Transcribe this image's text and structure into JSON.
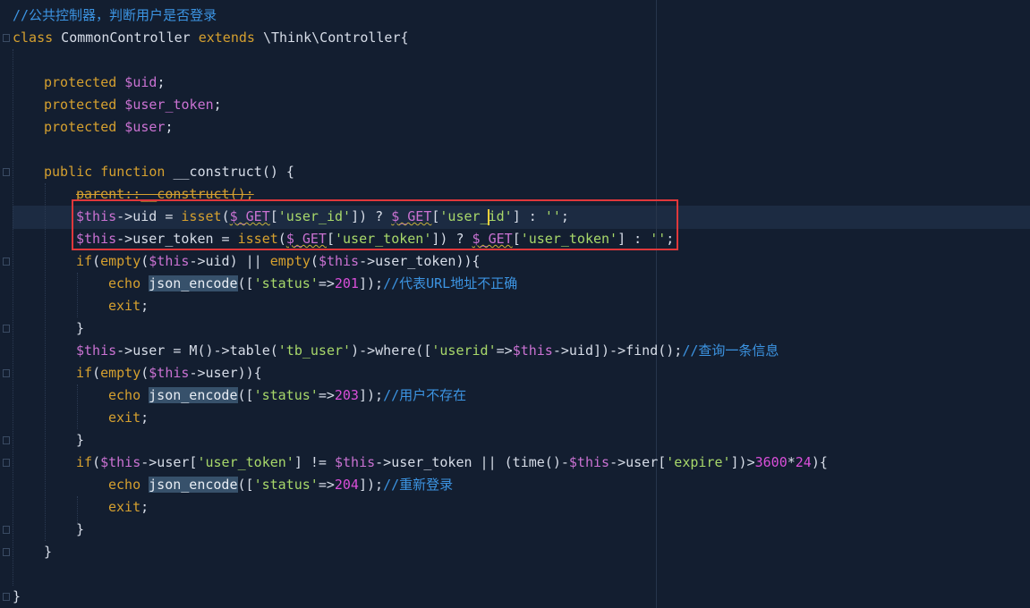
{
  "code": {
    "l1_comment": "//公共控制器，判断用户是否登录",
    "l2_class_kw": "class",
    "l2_class_name": " CommonController ",
    "l2_extends_kw": "extends",
    "l2_parent": " \\Think\\Controller{",
    "l3_prot": "protected",
    "l3_var": " $uid",
    "l3_end": ";",
    "l4_prot": "protected",
    "l4_var": " $user_token",
    "l4_end": ";",
    "l5_prot": "protected",
    "l5_var": " $user",
    "l5_end": ";",
    "l6_public": "public",
    "l6_function": " function",
    "l6_rest": " __construct() {",
    "l7_parent": "parent::__construct();",
    "l8_this": "$this",
    "l8_a": "->uid = ",
    "l8_isset": "isset",
    "l8_b": "(",
    "l8_get1": "$_GET",
    "l8_c": "[",
    "l8_str1": "'user_id'",
    "l8_d": "]) ? ",
    "l8_get2": "$_GET",
    "l8_e": "[",
    "l8_str2": "'user_id'",
    "l8_f": "] : ",
    "l8_str3": "''",
    "l8_g": ";",
    "l9_this": "$this",
    "l9_a": "->user_token = ",
    "l9_isset": "isset",
    "l9_b": "(",
    "l9_get1": "$_GET",
    "l9_c": "[",
    "l9_str1": "'user_token'",
    "l9_d": "]) ? ",
    "l9_get2": "$_GET",
    "l9_e": "[",
    "l9_str2": "'user_token'",
    "l9_f": "] : ",
    "l9_str3": "''",
    "l9_g": ";",
    "l10_if": "if",
    "l10_a": "(",
    "l10_empty1": "empty",
    "l10_b": "(",
    "l10_this1": "$this",
    "l10_c": "->uid) || ",
    "l10_empty2": "empty",
    "l10_d": "(",
    "l10_this2": "$this",
    "l10_e": "->user_token)){",
    "l11_echo": "echo",
    "l11_fn": "json_encode",
    "l11_a": "([",
    "l11_str": "'status'",
    "l11_b": "=>",
    "l11_num": "201",
    "l11_c": "]);",
    "l11_comment": "//代表URL地址不正确",
    "l12_exit": "exit",
    "l12_end": ";",
    "l13_close": "}",
    "l14_this": "$this",
    "l14_a": "->user = M()->table(",
    "l14_str1": "'tb_user'",
    "l14_b": ")->where([",
    "l14_str2": "'userid'",
    "l14_c": "=>",
    "l14_this2": "$this",
    "l14_d": "->uid])->find();",
    "l14_comment": "//查询一条信息",
    "l15_if": "if",
    "l15_a": "(",
    "l15_empty": "empty",
    "l15_b": "(",
    "l15_this": "$this",
    "l15_c": "->user)){",
    "l16_echo": "echo",
    "l16_fn": "json_encode",
    "l16_a": "([",
    "l16_str": "'status'",
    "l16_b": "=>",
    "l16_num": "203",
    "l16_c": "]);",
    "l16_comment": "//用户不存在",
    "l17_exit": "exit",
    "l17_end": ";",
    "l18_close": "}",
    "l19_if": "if",
    "l19_a": "(",
    "l19_this1": "$this",
    "l19_b": "->user[",
    "l19_str1": "'user_token'",
    "l19_c": "] != ",
    "l19_this2": "$this",
    "l19_d": "->user_token || (time()-",
    "l19_this3": "$this",
    "l19_e": "->user[",
    "l19_str2": "'expire'",
    "l19_f": "])>",
    "l19_num1": "3600",
    "l19_g": "*",
    "l19_num2": "24",
    "l19_h": "){",
    "l20_echo": "echo",
    "l20_fn": "json_encode",
    "l20_a": "([",
    "l20_str": "'status'",
    "l20_b": "=>",
    "l20_num": "204",
    "l20_c": "]);",
    "l20_comment": "//重新登录",
    "l21_exit": "exit",
    "l21_end": ";",
    "l22_close": "}",
    "l23_close": "}",
    "l24_close": "}"
  },
  "colors": {
    "background": "#131e30",
    "comment": "#3c94e2",
    "keyword": "#d5a02f",
    "variable": "#ca72d2",
    "string": "#a8d86a",
    "number": "#d94fd9",
    "selection_box": "#e0383b"
  }
}
